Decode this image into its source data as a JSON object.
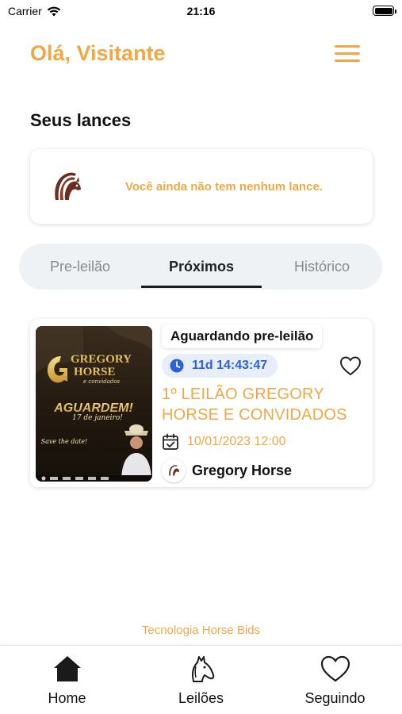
{
  "status_bar": {
    "carrier": "Carrier",
    "time": "21:16"
  },
  "header": {
    "greeting": "Olá, Visitante",
    "menu_icon": "hamburger-menu-icon"
  },
  "bids": {
    "title": "Seus lances",
    "empty_message": "Você ainda não tem nenhum lance."
  },
  "tabs": [
    {
      "label": "Pre-leilão",
      "active": false
    },
    {
      "label": "Próximos",
      "active": true
    },
    {
      "label": "Histórico",
      "active": false
    }
  ],
  "auction": {
    "status": "Aguardando pre-leilão",
    "countdown": "11d 14:43:47",
    "title": "1º LEILÃO GREGORY HORSE E CONVIDADOS",
    "date": "10/01/2023 12:00",
    "owner": "Gregory Horse",
    "poster": {
      "brand_top": "GREGORY",
      "brand_bottom": "HORSE",
      "brand_sub": "e convidados",
      "headline": "AGUARDEM!",
      "date_line": "17 de janeiro!",
      "tagline": "Save the date!"
    }
  },
  "footer": {
    "powered_by": "Tecnologia Horse Bids"
  },
  "bottom_nav": [
    {
      "label": "Home",
      "icon": "home-icon"
    },
    {
      "label": "Leilões",
      "icon": "horse-head-icon"
    },
    {
      "label": "Seguindo",
      "icon": "heart-icon"
    }
  ],
  "colors": {
    "accent": "#f0a846",
    "timer_text": "#2b62d9",
    "timer_bg": "#e7eef9",
    "tabs_bg": "#eef2f5"
  }
}
